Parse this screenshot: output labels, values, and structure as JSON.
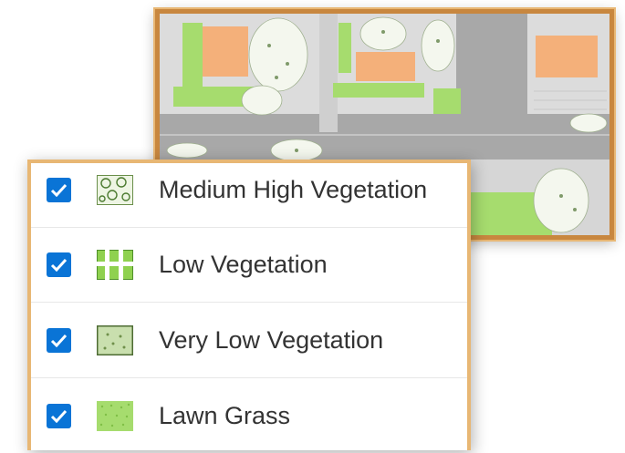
{
  "legend": {
    "items": [
      {
        "label": "Medium High Vegetation",
        "checked": true,
        "symbol": "medium-high-vegetation-swatch"
      },
      {
        "label": "Low Vegetation",
        "checked": true,
        "symbol": "low-vegetation-swatch"
      },
      {
        "label": "Very Low Vegetation",
        "checked": true,
        "symbol": "very-low-vegetation-swatch"
      },
      {
        "label": "Lawn Grass",
        "checked": true,
        "symbol": "lawn-grass-swatch"
      }
    ]
  },
  "colors": {
    "checkbox": "#0a74d6",
    "frame_border": "#c8873f",
    "road": "#a6a6a6",
    "building": "#f4b07a",
    "lawn": "#a6dc6e",
    "tree": "#f4f7ee"
  }
}
